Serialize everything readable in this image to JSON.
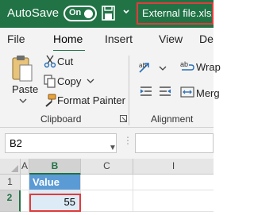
{
  "title_bar": {
    "autosave_label": "AutoSave",
    "toggle_state": "On",
    "file_name": "External file.xlsx",
    "colors": {
      "background": "#217346",
      "highlight": "#e23b3b"
    }
  },
  "ribbon_tabs": [
    "File",
    "Home",
    "Insert",
    "View",
    "De"
  ],
  "ribbon": {
    "clipboard": {
      "paste_label": "Paste",
      "cut_label": "Cut",
      "copy_label": "Copy",
      "format_painter_label": "Format Painter",
      "group_label": "Clipboard"
    },
    "alignment": {
      "wrap_label": "Wrap",
      "merge_label": "Merg",
      "group_label": "Alignment"
    }
  },
  "formula_bar": {
    "name_box": "B2",
    "formula": ""
  },
  "grid": {
    "columns": [
      "A",
      "B",
      "C",
      "I"
    ],
    "rows": [
      "1",
      "2"
    ],
    "cells": {
      "B1": "Value",
      "B2": "55"
    },
    "selected_cell": "B2"
  }
}
